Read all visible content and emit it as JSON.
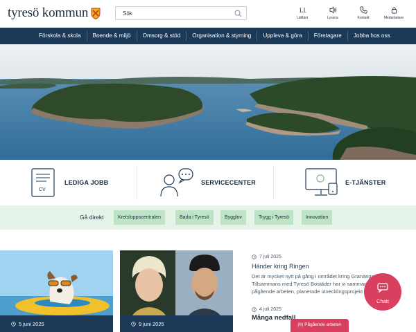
{
  "header": {
    "logo_text": "tyresö kommun",
    "search_placeholder": "Sök",
    "tools": [
      {
        "label": "Lättläst",
        "icon": "easy-read-icon"
      },
      {
        "label": "Lyssna",
        "icon": "speaker-icon"
      },
      {
        "label": "Kontakt",
        "icon": "phone-icon"
      },
      {
        "label": "Medarbetare",
        "icon": "lock-icon"
      }
    ]
  },
  "nav": {
    "items": [
      "Förskola & skola",
      "Boende & miljö",
      "Omsorg & stöd",
      "Organisation & styrning",
      "Uppleva & göra",
      "Företagare",
      "Jobba hos oss"
    ]
  },
  "quick_links": {
    "jobs": "LEDIGA JOBB",
    "jobs_icon_text": "CV",
    "service": "SERVICECENTER",
    "eservices": "E-TJÄNSTER"
  },
  "direct": {
    "label": "Gå direkt",
    "chips": [
      "Kretsloppscentralen",
      "Bada i Tyresö",
      "Bygglov",
      "Trygg i Tyresö",
      "Innovation"
    ]
  },
  "cards": [
    {
      "date": "5 juni 2025"
    },
    {
      "date": "9 juni 2025"
    }
  ],
  "news": [
    {
      "date": "7 juli 2025",
      "title": "Händer kring Ringen",
      "text": "Det är mycket nytt på gång i området kring Granängsringen. Tillsammans med Tyresö Bostäder har vi sammanställt pågående arbeten, planerade utvecklingsprojekt samt aktiviteter."
    },
    {
      "date": "4 juli 2025",
      "title": "Många nedfall"
    }
  ],
  "chat": {
    "label": "Chatt"
  },
  "badge": {
    "label": "(6) Pågående arbeten"
  },
  "colors": {
    "navy": "#1c3a57",
    "pink": "#d94060",
    "green_light": "#e6f3e8",
    "chip": "#bfe3c6"
  }
}
